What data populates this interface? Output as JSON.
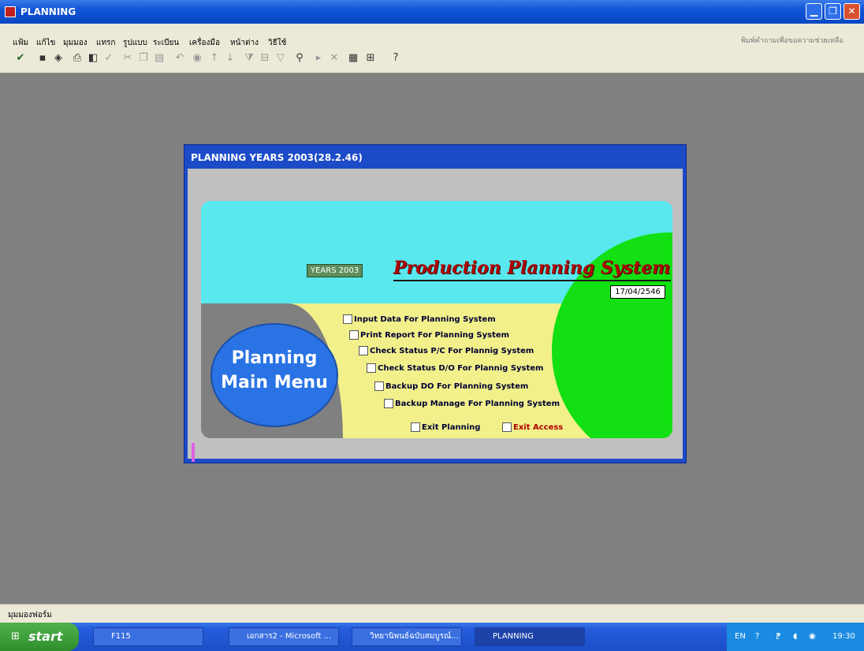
{
  "window": {
    "title": "PLANNING",
    "min_icon": "minimize-icon",
    "max_icon": "maximize-icon",
    "close_icon": "close-icon"
  },
  "menu": {
    "items": [
      "แฟ้ม",
      "แก้ไข",
      "มุมมอง",
      "แทรก",
      "รูปแบบ",
      "ระเบียน",
      "เครื่องมือ",
      "หน้าต่าง",
      "วิธีใช้"
    ],
    "help_placeholder": "พิมพ์คำถามเพื่อขอความช่วยเหลือ"
  },
  "dialog": {
    "title": "PLANNING YEARS 2003(28.2.46)",
    "years_badge": "YEARS 2003",
    "product_title": "Production Planning System",
    "date": "17/04/2546",
    "main_menu_line1": "Planning",
    "main_menu_line2": "Main Menu",
    "options": [
      "Input Data For Planning System",
      "Print Report For Planning System",
      "Check Status P/C For Plannig System",
      "Check Status D/O For Plannig System",
      "Backup DO For Planning System",
      "Backup Manage For Planning System"
    ],
    "exit_planning": "Exit Planning",
    "exit_access": "Exit Access"
  },
  "status": {
    "text": "มุมมองฟอร์ม"
  },
  "taskbar": {
    "start": "start",
    "tasks": [
      "F115",
      "เอกสาร2 - Microsoft ...",
      "วิทยานิพนธ์ฉบับสมบูรณ์...",
      "PLANNING"
    ],
    "lang": "EN",
    "time": "19:30"
  }
}
